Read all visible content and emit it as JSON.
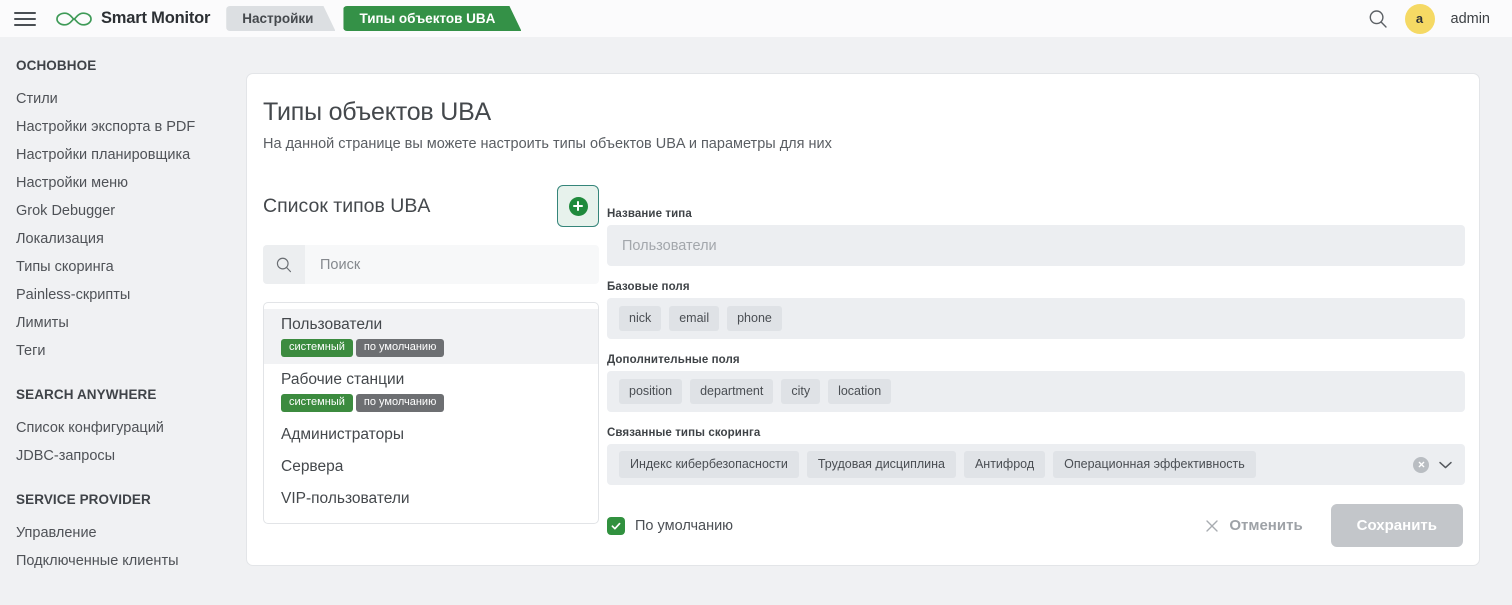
{
  "topbar": {
    "menu_icon": "hamburger-icon",
    "logo_icon": "infinity-logo-icon",
    "brand": "Smart Monitor",
    "breadcrumbs": [
      {
        "label": "Настройки",
        "active": false
      },
      {
        "label": "Типы объектов UBA",
        "active": true
      }
    ],
    "search_icon": "search-icon",
    "avatar_initial": "a",
    "username": "admin",
    "accent_green": "#349147",
    "avatar_yellow": "#f5d964"
  },
  "sidebar": {
    "sections": [
      {
        "title": "ОСНОВНОЕ",
        "items": [
          "Стили",
          "Настройки экспорта в PDF",
          "Настройки планировщика",
          "Настройки меню",
          "Grok Debugger",
          "Локализация",
          "Типы скоринга",
          "Painless-скрипты",
          "Лимиты",
          "Теги"
        ]
      },
      {
        "title": "SEARCH ANYWHERE",
        "items": [
          "Список конфигураций",
          "JDBC-запросы"
        ]
      },
      {
        "title": "SERVICE PROVIDER",
        "items": [
          "Управление",
          "Подключенные клиенты"
        ]
      }
    ]
  },
  "main": {
    "title": "Типы объектов UBA",
    "subtitle": "На данной странице вы можете настроить типы объектов UBA и параметры для них",
    "list_panel": {
      "title": "Список типов UBA",
      "add_button_icon": "plus-circle-icon",
      "search_icon": "search-icon",
      "search_value": "",
      "search_placeholder": "Поиск",
      "items": [
        {
          "name": "Пользователи",
          "selected": true,
          "badges": [
            {
              "label": "системный",
              "kind": "sys"
            },
            {
              "label": "по умолчанию",
              "kind": "def"
            }
          ]
        },
        {
          "name": "Рабочие станции",
          "selected": false,
          "badges": [
            {
              "label": "системный",
              "kind": "sys"
            },
            {
              "label": "по умолчанию",
              "kind": "def"
            }
          ]
        },
        {
          "name": "Администраторы",
          "selected": false,
          "badges": []
        },
        {
          "name": "Сервера",
          "selected": false,
          "badges": []
        },
        {
          "name": "VIP-пользователи",
          "selected": false,
          "badges": []
        }
      ]
    },
    "form": {
      "type_name": {
        "label": "Название типа",
        "value": "Пользователи",
        "disabled": true
      },
      "base_fields": {
        "label": "Базовые поля",
        "chips": [
          "nick",
          "email",
          "phone"
        ]
      },
      "extra_fields": {
        "label": "Дополнительные поля",
        "chips": [
          "position",
          "department",
          "city",
          "location"
        ]
      },
      "scoring_types": {
        "label": "Связанные типы скоринга",
        "chips": [
          "Индекс кибербезопасности",
          "Трудовая дисциплина",
          "Антифрод",
          "Операционная эффективность"
        ],
        "clear_icon": "clear-circle-icon",
        "dropdown_icon": "chevron-down-icon"
      },
      "default_checkbox": {
        "label": "По умолчанию",
        "checked": true,
        "icon": "check-icon"
      },
      "cancel": {
        "label": "Отменить",
        "icon": "close-icon"
      },
      "save": {
        "label": "Сохранить",
        "disabled": true
      }
    }
  }
}
